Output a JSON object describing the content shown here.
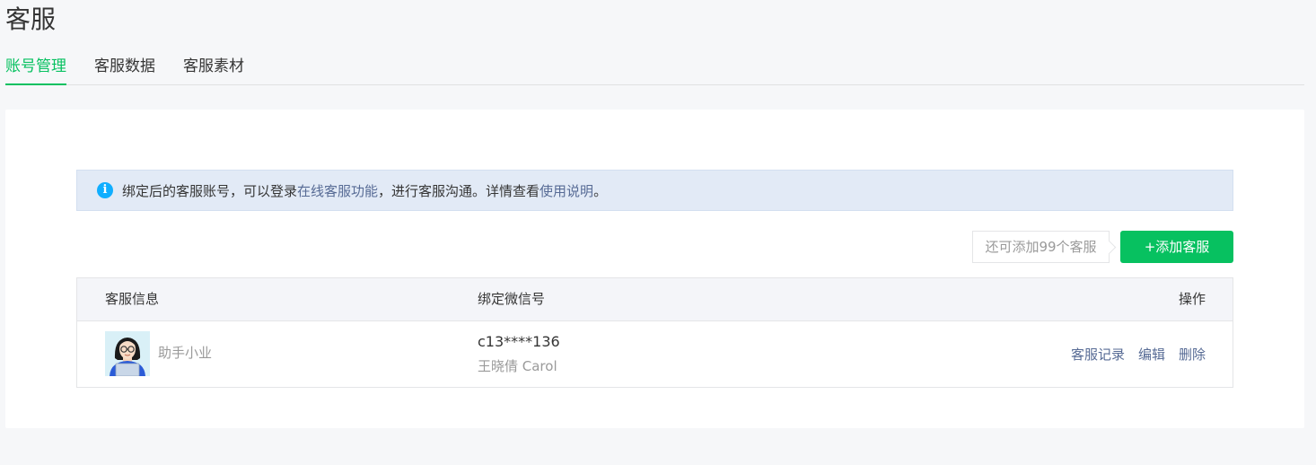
{
  "page": {
    "title": "客服"
  },
  "tabs": [
    {
      "label": "账号管理",
      "active": true
    },
    {
      "label": "客服数据",
      "active": false
    },
    {
      "label": "客服素材",
      "active": false
    }
  ],
  "notice": {
    "icon": "info-icon",
    "text_1": "绑定后的客服账号，可以登录",
    "link_1": "在线客服功能",
    "text_2": "，进行客服沟通。详情查看",
    "link_2": "使用说明",
    "text_3": "。"
  },
  "toolbar": {
    "quota_text": "还可添加99个客服",
    "add_button": "+添加客服"
  },
  "table": {
    "columns": [
      "客服信息",
      "绑定微信号",
      "操作"
    ],
    "rows": [
      {
        "avatar": "avatar-image",
        "nickname": "助手小业",
        "wechat_id": "c13****136",
        "wechat_name": "王晓倩 Carol",
        "actions": [
          "客服记录",
          "编辑",
          "删除"
        ]
      }
    ]
  },
  "colors": {
    "accent": "#07c160",
    "link": "#576b95",
    "notice_bg": "#e2eaf6",
    "info_icon": "#10aeff"
  }
}
